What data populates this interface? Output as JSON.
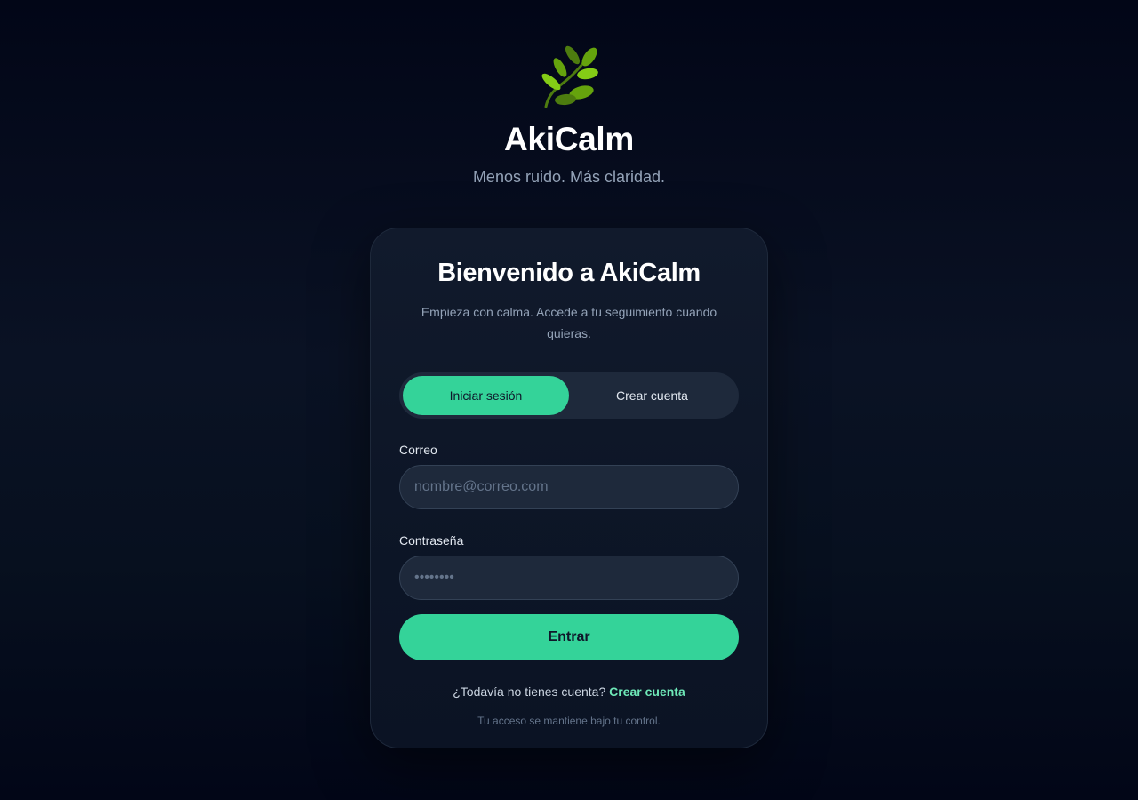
{
  "brand": {
    "icon": "herb-leaf-icon",
    "name": "AkiCalm",
    "tagline": "Menos ruido. Más claridad."
  },
  "card": {
    "title": "Bienvenido a AkiCalm",
    "subtitle": "Empieza con calma. Accede a tu seguimiento cuando quieras."
  },
  "tabs": {
    "selected": "Iniciar sesión",
    "items": [
      {
        "label": "Iniciar sesión"
      },
      {
        "label": "Crear cuenta"
      }
    ]
  },
  "form": {
    "email": {
      "label": "Correo",
      "placeholder": "nombre@correo.com",
      "value": ""
    },
    "password": {
      "label": "Contraseña",
      "placeholder": "••••••••",
      "value": ""
    },
    "submit_label": "Entrar"
  },
  "signup": {
    "prompt": "¿Todavía no tienes cuenta?",
    "link_label": "Crear cuenta"
  },
  "footnote": "Tu acceso se mantiene bajo tu control.",
  "colors": {
    "accent": "#34d399",
    "accent_text": "#6ee7b7",
    "background": "#020617",
    "card": "#0f172a",
    "input": "#1e293b"
  }
}
